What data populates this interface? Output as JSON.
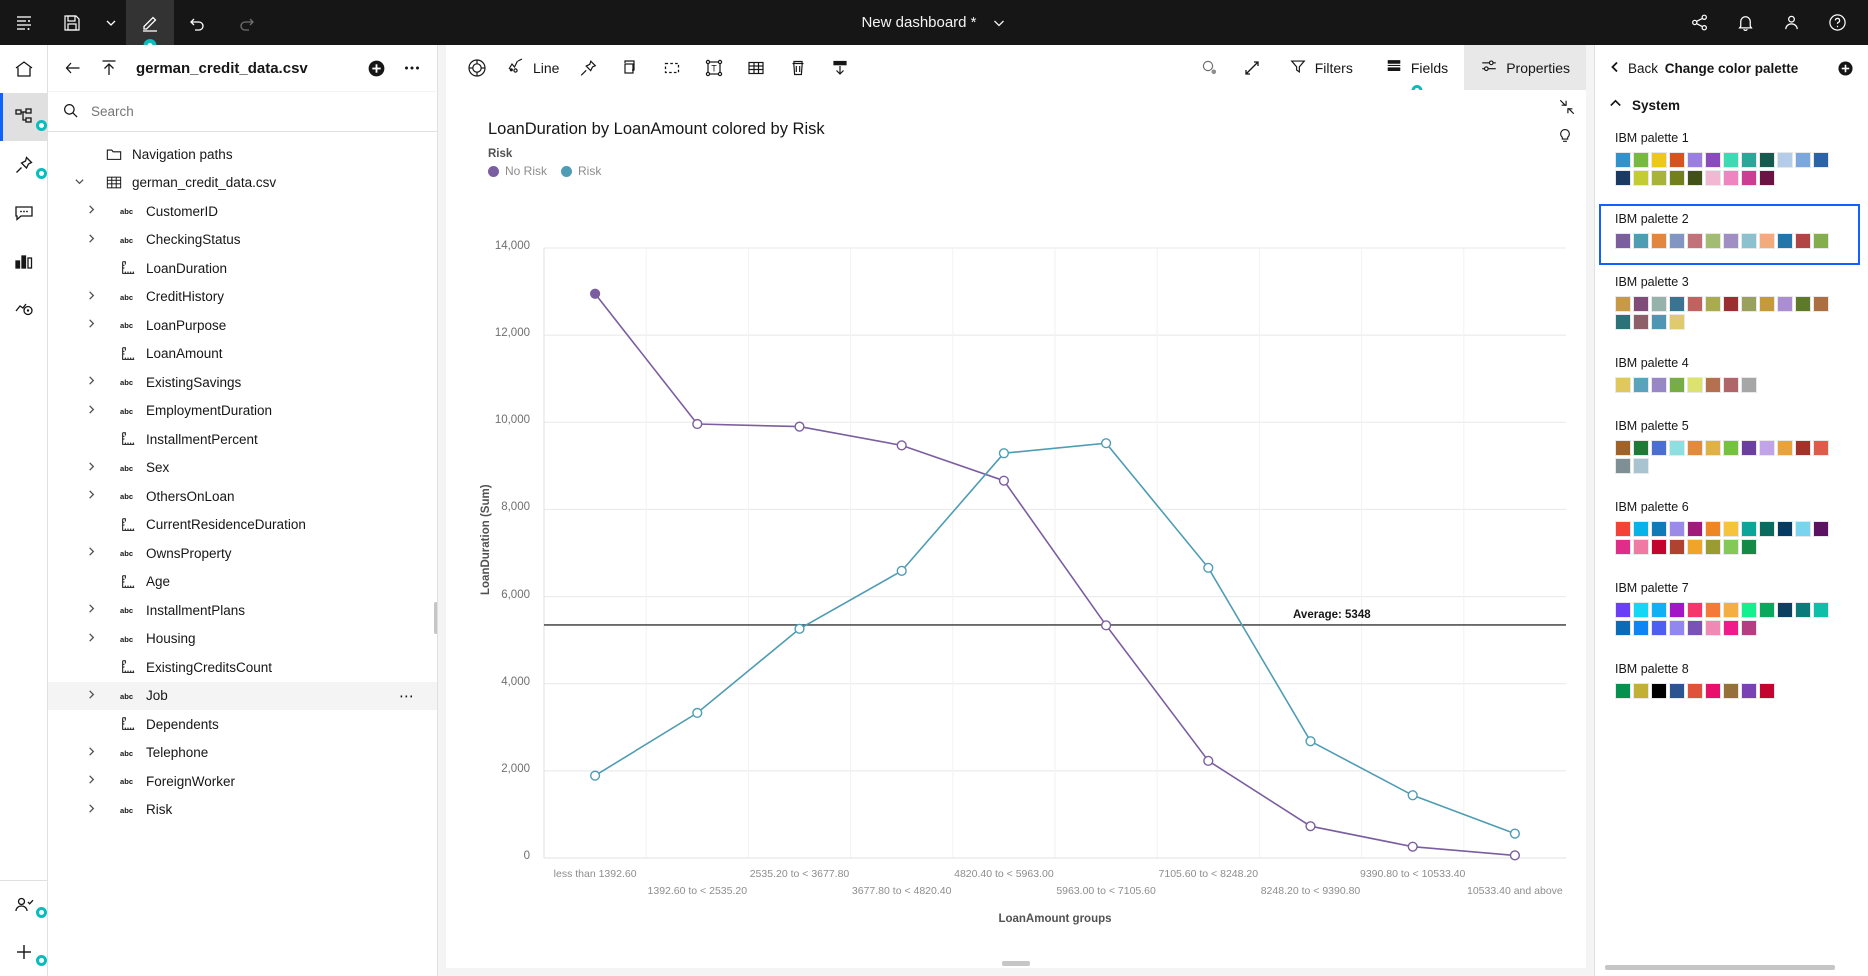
{
  "topbar": {
    "title": "New dashboard *",
    "left_buttons": [
      {
        "name": "menu-panel-icon",
        "label": "menu"
      },
      {
        "name": "save-icon",
        "label": "save"
      },
      {
        "name": "save-chevron-icon",
        "label": "save options"
      },
      {
        "name": "edit-pencil-icon",
        "label": "edit"
      },
      {
        "name": "undo-icon",
        "label": "undo"
      },
      {
        "name": "redo-icon",
        "label": "redo"
      }
    ],
    "right_buttons": [
      {
        "name": "share-icon",
        "label": "share"
      },
      {
        "name": "notification-bell-icon",
        "label": "notifications"
      },
      {
        "name": "user-avatar-icon",
        "label": "account"
      },
      {
        "name": "help-icon",
        "label": "help"
      }
    ]
  },
  "rail": {
    "items": [
      {
        "name": "home-icon",
        "label": "Home",
        "selected": false,
        "dot": false
      },
      {
        "name": "sources-tree-icon",
        "label": "Sources",
        "selected": true,
        "dot": true
      },
      {
        "name": "pin-icon",
        "label": "Pinned",
        "selected": false,
        "dot": true
      },
      {
        "name": "comment-icon",
        "label": "Comments",
        "selected": false,
        "dot": false
      },
      {
        "name": "chart-icon",
        "label": "Visualizations",
        "selected": false,
        "dot": false
      },
      {
        "name": "explore-icon",
        "label": "Explore",
        "selected": false,
        "dot": false
      }
    ],
    "bottom_items": [
      {
        "name": "collaborate-user-icon",
        "label": "Collaborate",
        "dot": true
      },
      {
        "name": "add-plus-icon",
        "label": "Add",
        "dot": true
      }
    ]
  },
  "data_panel": {
    "title": "german_credit_data.csv",
    "back_icon": "back-arrow-icon",
    "upload_icon": "upload-icon",
    "add_icon": "add-source-icon",
    "overflow_icon": "overflow-menu-icon",
    "search": {
      "placeholder": "Search",
      "value": ""
    },
    "tree": [
      {
        "label": "Navigation paths",
        "type": "folder",
        "level": 0,
        "expandable": false,
        "icon": "folder-icon"
      },
      {
        "label": "german_credit_data.csv",
        "type": "table",
        "level": 0,
        "expandable": true,
        "expanded": true,
        "icon": "table-icon"
      },
      {
        "label": "CustomerID",
        "type": "text",
        "level": 1,
        "expandable": true,
        "icon": "abc-icon"
      },
      {
        "label": "CheckingStatus",
        "type": "text",
        "level": 1,
        "expandable": true,
        "icon": "abc-icon"
      },
      {
        "label": "LoanDuration",
        "type": "measure",
        "level": 1,
        "expandable": false,
        "icon": "measure-icon"
      },
      {
        "label": "CreditHistory",
        "type": "text",
        "level": 1,
        "expandable": true,
        "icon": "abc-icon"
      },
      {
        "label": "LoanPurpose",
        "type": "text",
        "level": 1,
        "expandable": true,
        "icon": "abc-icon"
      },
      {
        "label": "LoanAmount",
        "type": "measure",
        "level": 1,
        "expandable": false,
        "icon": "measure-icon"
      },
      {
        "label": "ExistingSavings",
        "type": "text",
        "level": 1,
        "expandable": true,
        "icon": "abc-icon"
      },
      {
        "label": "EmploymentDuration",
        "type": "text",
        "level": 1,
        "expandable": true,
        "icon": "abc-icon"
      },
      {
        "label": "InstallmentPercent",
        "type": "measure",
        "level": 1,
        "expandable": false,
        "icon": "measure-icon"
      },
      {
        "label": "Sex",
        "type": "text",
        "level": 1,
        "expandable": true,
        "icon": "abc-icon"
      },
      {
        "label": "OthersOnLoan",
        "type": "text",
        "level": 1,
        "expandable": true,
        "icon": "abc-icon"
      },
      {
        "label": "CurrentResidenceDuration",
        "type": "measure",
        "level": 1,
        "expandable": false,
        "icon": "measure-icon"
      },
      {
        "label": "OwnsProperty",
        "type": "text",
        "level": 1,
        "expandable": true,
        "icon": "abc-icon"
      },
      {
        "label": "Age",
        "type": "measure",
        "level": 1,
        "expandable": false,
        "icon": "measure-icon"
      },
      {
        "label": "InstallmentPlans",
        "type": "text",
        "level": 1,
        "expandable": true,
        "icon": "abc-icon"
      },
      {
        "label": "Housing",
        "type": "text",
        "level": 1,
        "expandable": true,
        "icon": "abc-icon"
      },
      {
        "label": "ExistingCreditsCount",
        "type": "measure",
        "level": 1,
        "expandable": false,
        "icon": "measure-icon"
      },
      {
        "label": "Job",
        "type": "text",
        "level": 1,
        "expandable": true,
        "icon": "abc-icon",
        "hovered": true,
        "overflow": "⋯"
      },
      {
        "label": "Dependents",
        "type": "measure",
        "level": 1,
        "expandable": false,
        "icon": "measure-icon"
      },
      {
        "label": "Telephone",
        "type": "text",
        "level": 1,
        "expandable": true,
        "icon": "abc-icon"
      },
      {
        "label": "ForeignWorker",
        "type": "text",
        "level": 1,
        "expandable": true,
        "icon": "abc-icon"
      },
      {
        "label": "Risk",
        "type": "text",
        "level": 1,
        "expandable": true,
        "icon": "abc-icon"
      }
    ]
  },
  "chart_toolbar": {
    "left": [
      {
        "name": "target-style-icon",
        "label": ""
      },
      {
        "name": "chart-type-icon",
        "label": "Line"
      },
      {
        "name": "pin-icon",
        "label": ""
      },
      {
        "name": "copy-icon",
        "label": ""
      },
      {
        "name": "select-region-icon",
        "label": ""
      },
      {
        "name": "text-box-icon",
        "label": ""
      },
      {
        "name": "grid-table-icon",
        "label": ""
      },
      {
        "name": "delete-trash-icon",
        "label": ""
      },
      {
        "name": "download-icon",
        "label": ""
      }
    ],
    "right": [
      {
        "name": "zoom-icon",
        "label": ""
      },
      {
        "name": "expand-icon",
        "label": ""
      },
      {
        "name": "filters-tab",
        "label": "Filters",
        "icon": "filter-funnel-icon",
        "active": false,
        "dot": false
      },
      {
        "name": "fields-tab",
        "label": "Fields",
        "icon": "fields-stack-icon",
        "active": false,
        "dot": true
      },
      {
        "name": "properties-tab",
        "label": "Properties",
        "icon": "properties-sliders-icon",
        "active": true,
        "dot": false
      }
    ]
  },
  "visualization": {
    "collapse_icon": "collapse-arrows-icon",
    "bulb_icon": "insight-bulb-icon"
  },
  "properties_panel": {
    "back_label": "Back",
    "title": "Change color palette",
    "add_icon": "add-palette-icon",
    "section_label": "System",
    "section_expanded": true,
    "palettes": [
      {
        "name": "IBM palette 1",
        "selected": false,
        "colors": [
          "#3392cc",
          "#76bb40",
          "#ecc81a",
          "#d5541f",
          "#9a7ee0",
          "#8a4bbf",
          "#3ddbb4",
          "#2ba79a",
          "#16594f",
          "#b3cde8",
          "#7aa8dd",
          "#2c62a8",
          "#1a3a63",
          "#c3cc33",
          "#a8b33a",
          "#73801e",
          "#425216",
          "#f2b8d2",
          "#ef85c0",
          "#cc3d94",
          "#6b1344"
        ]
      },
      {
        "name": "IBM palette 2",
        "selected": true,
        "colors": [
          "#7a5ea0",
          "#4f9cb5",
          "#e2873f",
          "#8296c4",
          "#c4727a",
          "#a2bd72",
          "#9f8fc4",
          "#8cc2cf",
          "#f2ab7d",
          "#2576a8",
          "#b14444",
          "#84ad4c"
        ]
      },
      {
        "name": "IBM palette 3",
        "selected": false,
        "colors": [
          "#c99a46",
          "#7f4d77",
          "#96b2ab",
          "#3a7491",
          "#c06360",
          "#a8ab4e",
          "#9b2f2f",
          "#9aa05e",
          "#c49a3a",
          "#ab8ed1",
          "#5d7a28",
          "#ab6f41",
          "#2b7279",
          "#8d5f68",
          "#4e96b3",
          "#e0ca6e"
        ]
      },
      {
        "name": "IBM palette 4",
        "selected": false,
        "colors": [
          "#e0c85f",
          "#5aa2bd",
          "#9787c7",
          "#76ad44",
          "#dbe270",
          "#b5714f",
          "#b26568",
          "#a6a6a6"
        ]
      },
      {
        "name": "IBM palette 5",
        "selected": false,
        "colors": [
          "#a06229",
          "#1f7a37",
          "#4a6fd1",
          "#8ee0e0",
          "#e28b3d",
          "#e0b144",
          "#75c23f",
          "#6b3fa0",
          "#c1a3e8",
          "#e8a43a",
          "#a33228",
          "#e05c4a",
          "#7e8f96",
          "#a9c4d1"
        ]
      },
      {
        "name": "IBM palette 6",
        "selected": false,
        "colors": [
          "#f44336",
          "#06b4e8",
          "#0f7ab5",
          "#9c8ae8",
          "#a2197c",
          "#ef8625",
          "#f5c33c",
          "#0ba699",
          "#0a6b5e",
          "#063b63",
          "#7ad4f0",
          "#5c1163",
          "#e02d8a",
          "#ef7ba5",
          "#c2042f",
          "#b04230",
          "#f0a429",
          "#9a9c32",
          "#84c958",
          "#148a47"
        ]
      },
      {
        "name": "IBM palette 7",
        "selected": false,
        "colors": [
          "#6b3ff5",
          "#14d6f5",
          "#11b0f5",
          "#a315c7",
          "#f5356b",
          "#f57a38",
          "#f5ae42",
          "#14f08e",
          "#0aa85c",
          "#0d4060",
          "#0a7a7a",
          "#0dbfa8",
          "#0d6bb5",
          "#0f85f5",
          "#4f5ef2",
          "#9287ef",
          "#7a52b5",
          "#f08ab5",
          "#f01b8a",
          "#b53d82"
        ]
      },
      {
        "name": "IBM palette 8",
        "selected": false,
        "colors": [
          "#07914f",
          "#c2b035",
          "#000000",
          "#2c5490",
          "#e0533a",
          "#e8106b",
          "#95703a",
          "#7a41b5",
          "#c2042f"
        ]
      }
    ]
  },
  "chart_data": {
    "type": "line",
    "title": "LoanDuration by LoanAmount colored by Risk",
    "xlabel": "LoanAmount groups",
    "ylabel": "LoanDuration (Sum)",
    "ylim": [
      0,
      14000
    ],
    "yticks": [
      "0",
      "2,000",
      "4,000",
      "6,000",
      "8,000",
      "10,000",
      "12,000",
      "14,000"
    ],
    "ytick_values": [
      0,
      2000,
      4000,
      6000,
      8000,
      10000,
      12000,
      14000
    ],
    "grid": true,
    "legend_title": "Risk",
    "legend_position": "top-left",
    "categories": [
      "less than 1392.60",
      "1392.60 to < 2535.20",
      "2535.20 to < 3677.80",
      "3677.80 to < 4820.40",
      "4820.40 to < 5963.00",
      "5963.00 to < 7105.60",
      "7105.60 to < 8248.20",
      "8248.20 to < 9390.80",
      "9390.80 to < 10533.40",
      "10533.40 and above"
    ],
    "series": [
      {
        "name": "No Risk",
        "color": "#7a5ea0",
        "values": [
          12950,
          9960,
          9900,
          9470,
          8660,
          5340,
          2230,
          730,
          260,
          60
        ]
      },
      {
        "name": "Risk",
        "color": "#4f9cb5",
        "values": [
          1890,
          3330,
          5260,
          6590,
          9290,
          9520,
          6660,
          2680,
          1440,
          560
        ]
      }
    ],
    "reference_line": {
      "label": "Average: 5348",
      "value": 5348,
      "color": "#525252"
    }
  }
}
